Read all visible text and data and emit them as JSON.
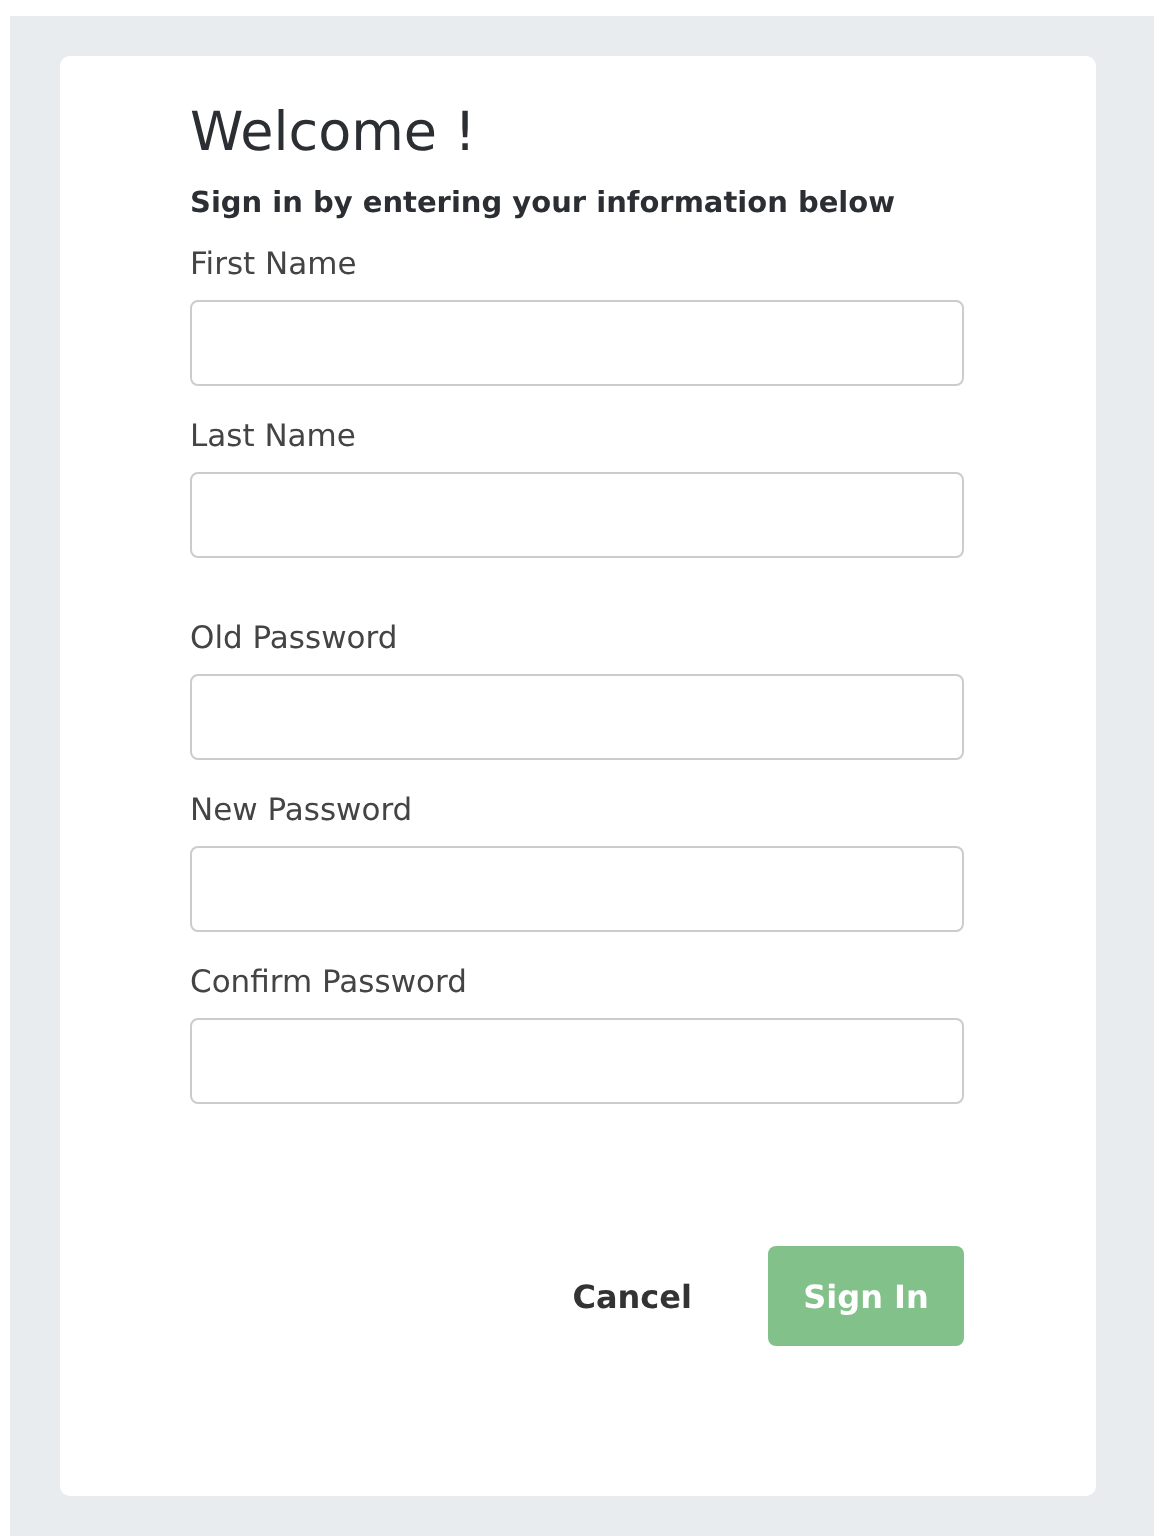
{
  "title": "Welcome !",
  "subtitle": "Sign in by entering your information below",
  "name_fields": [
    {
      "label": "First Name"
    },
    {
      "label": "Last Name"
    }
  ],
  "password_fields": [
    {
      "label": "Old Password"
    },
    {
      "label": "New Password"
    },
    {
      "label": "Confirm Password"
    }
  ],
  "buttons": [
    {
      "label": "Cancel",
      "kind": "text",
      "disabled": false
    },
    {
      "label": "Sign In",
      "kind": "primary",
      "disabled": true
    }
  ]
}
